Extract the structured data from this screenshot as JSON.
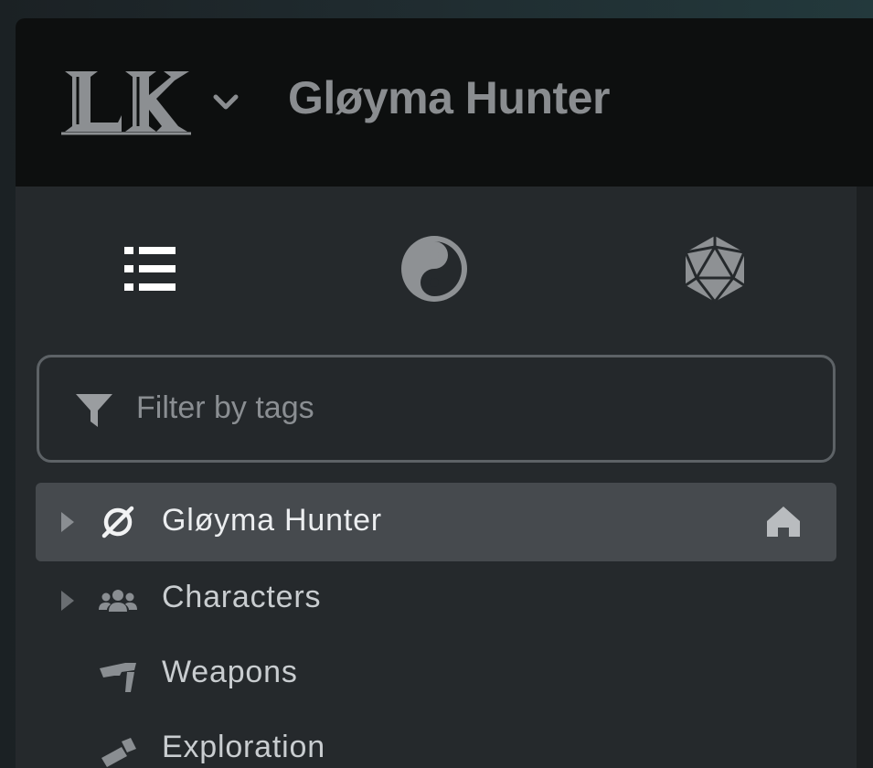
{
  "header": {
    "logo_text": "LK",
    "title": "Gløyma Hunter"
  },
  "sidebar": {
    "mode_tabs": [
      {
        "icon": "list-icon"
      },
      {
        "icon": "yin-yang-icon"
      },
      {
        "icon": "d20-dice-icon"
      }
    ],
    "filter": {
      "placeholder": "Filter by tags",
      "value": ""
    },
    "tree": [
      {
        "label": "Gløyma Hunter",
        "icon": "null-set-icon",
        "expandable": true,
        "selected": true,
        "home": true
      },
      {
        "label": "Characters",
        "icon": "users-icon",
        "expandable": true,
        "selected": false
      },
      {
        "label": "Weapons",
        "icon": "gun-icon",
        "expandable": false,
        "selected": false
      },
      {
        "label": "Exploration",
        "icon": "exploration-icon",
        "expandable": false,
        "selected": false
      }
    ]
  },
  "colors": {
    "header_bg": "#0d0f0f",
    "sidebar_bg": "#25292c",
    "selected_bg": "#464a4e",
    "muted_icon": "#8a8d90"
  }
}
